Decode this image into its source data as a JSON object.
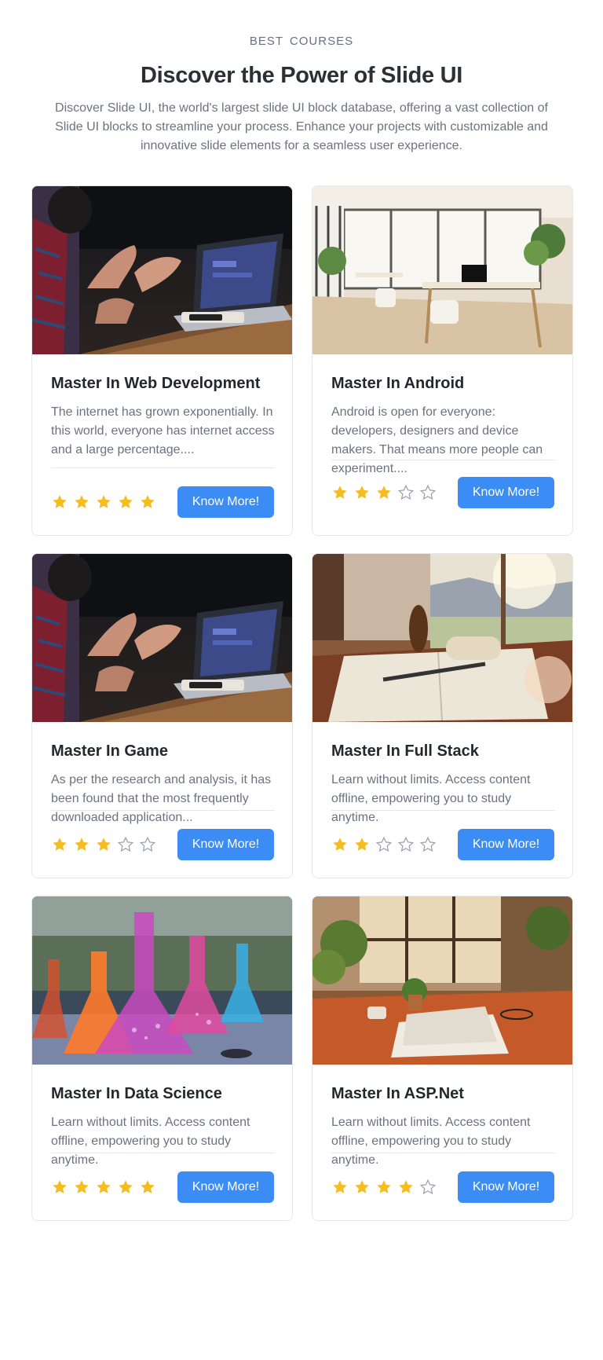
{
  "header": {
    "eyebrow": "BEST COURSES",
    "title": "Discover the Power of Slide UI",
    "subtitle": "Discover Slide UI, the world's largest slide UI block database, offering a vast collection of Slide UI blocks to streamline your process. Enhance your projects with customizable and innovative slide elements for a seamless user experience."
  },
  "colors": {
    "accent": "#3b8cf5",
    "star_filled": "#f5bd1f",
    "star_empty": "#9ca3af"
  },
  "courses": [
    {
      "title": "Master In Web Development",
      "description": "The internet has grown exponentially. In this world, everyone has internet access and a large percentage....",
      "rating": 5,
      "button": "Know More!",
      "image": "laptop-hands-photo"
    },
    {
      "title": "Master In Android",
      "description": "Android is open for everyone: developers, designers and device makers. That means more people can experiment....",
      "rating": 3,
      "button": "Know More!",
      "image": "bright-office-photo"
    },
    {
      "title": "Master In Game",
      "description": "As per the research and analysis, it has been found that the most frequently downloaded application...",
      "rating": 3,
      "button": "Know More!",
      "image": "laptop-hands-photo"
    },
    {
      "title": "Master In Full Stack",
      "description": "Learn without limits. Access content offline, empowering you to study anytime.",
      "rating": 2,
      "button": "Know More!",
      "image": "desk-book-pen-photo"
    },
    {
      "title": "Master In Data Science",
      "description": "Learn without limits. Access content offline, empowering you to study anytime.",
      "rating": 5,
      "button": "Know More!",
      "image": "lab-flasks-photo"
    },
    {
      "title": "Master In ASP.Net",
      "description": "Learn without limits. Access content offline, empowering you to study anytime.",
      "rating": 4,
      "button": "Know More!",
      "image": "sunny-desk-plants-photo"
    }
  ]
}
